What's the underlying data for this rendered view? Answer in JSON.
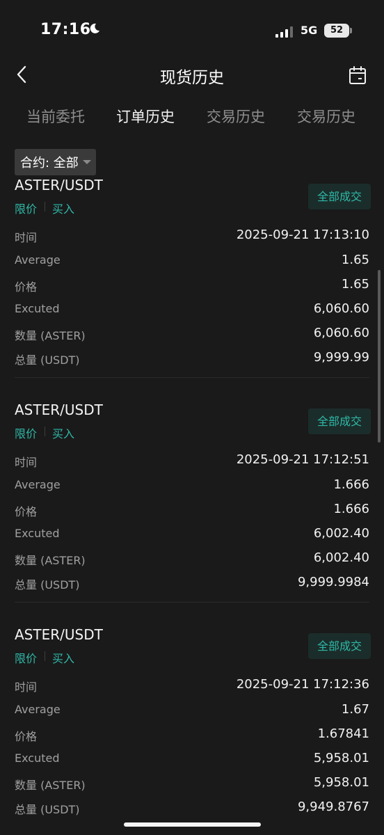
{
  "status_bar": {
    "time": "17:16",
    "network": "5G",
    "battery": "52"
  },
  "header": {
    "title": "现货历史"
  },
  "tabs": [
    {
      "label": "当前委托",
      "active": false
    },
    {
      "label": "订单历史",
      "active": true
    },
    {
      "label": "交易历史",
      "active": false
    },
    {
      "label": "交易历史",
      "active": false
    }
  ],
  "filter": {
    "label": "合约: 全部"
  },
  "colors": {
    "accent": "#2fb8a8",
    "background": "#1a1a1a",
    "badge_bg": "#1b2d2a"
  },
  "labels": {
    "time": "时间",
    "average": "Average",
    "price": "价格",
    "executed": "Excuted",
    "quantity": "数量 (ASTER)",
    "total": "总量 (USDT)"
  },
  "orders": [
    {
      "pair": "ASTER/USDT",
      "type": "限价",
      "side": "买入",
      "status": "全部成交",
      "time": "2025-09-21 17:13:10",
      "average": "1.65",
      "price": "1.65",
      "executed": "6,060.60",
      "quantity": "6,060.60",
      "total": "9,999.99"
    },
    {
      "pair": "ASTER/USDT",
      "type": "限价",
      "side": "买入",
      "status": "全部成交",
      "time": "2025-09-21 17:12:51",
      "average": "1.666",
      "price": "1.666",
      "executed": "6,002.40",
      "quantity": "6,002.40",
      "total": "9,999.9984"
    },
    {
      "pair": "ASTER/USDT",
      "type": "限价",
      "side": "买入",
      "status": "全部成交",
      "time": "2025-09-21 17:12:36",
      "average": "1.67",
      "price": "1.67841",
      "executed": "5,958.01",
      "quantity": "5,958.01",
      "total": "9,949.8767"
    }
  ]
}
